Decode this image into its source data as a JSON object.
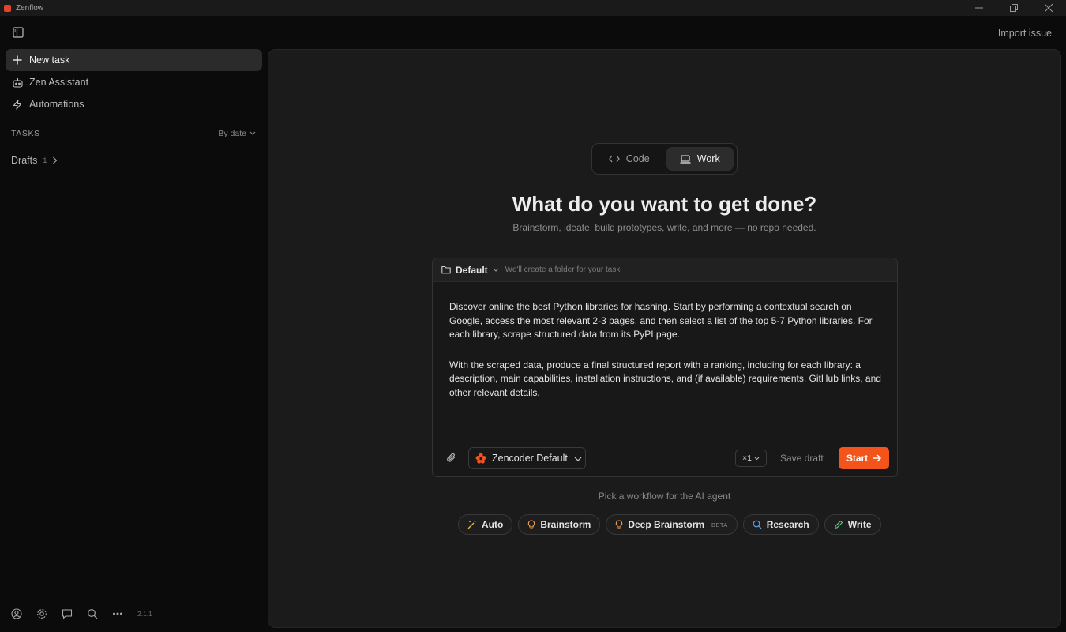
{
  "window": {
    "title": "Zenflow"
  },
  "header": {
    "import_issue": "Import issue"
  },
  "sidebar": {
    "nav": [
      {
        "label": "New task",
        "icon": "plus-icon",
        "active": true
      },
      {
        "label": "Zen Assistant",
        "icon": "robot-icon",
        "active": false
      },
      {
        "label": "Automations",
        "icon": "lightning-icon",
        "active": false
      }
    ],
    "tasks_label": "TASKS",
    "sort_label": "By date",
    "drafts": {
      "label": "Drafts",
      "count": "1"
    },
    "version": "2.1.1"
  },
  "main": {
    "modes": [
      {
        "label": "Code",
        "icon": "code-icon",
        "active": false
      },
      {
        "label": "Work",
        "icon": "laptop-icon",
        "active": true
      }
    ],
    "title": "What do you want to get done?",
    "subtitle": "Brainstorm, ideate, build prototypes, write, and more — no repo needed.",
    "composer": {
      "folder": "Default",
      "folder_hint": "We'll create a folder for your task",
      "paragraph1": "Discover online the best Python libraries for hashing. Start by performing a contextual search on Google, access the most relevant 2-3 pages, and then select a list of the top 5-7 Python libraries. For each library, scrape structured data from its PyPI page.",
      "paragraph2": "With the scraped data, produce a final structured report with a ranking, including for each library: a description, main capabilities, installation instructions, and (if available) requirements, GitHub links, and other relevant details.",
      "agent": "Zencoder Default",
      "count": "×1",
      "save_draft": "Save draft",
      "start": "Start"
    },
    "workflow_label": "Pick a workflow for the AI agent",
    "workflows": [
      {
        "label": "Auto",
        "icon": "magic-wand-icon",
        "color": "#e9b949"
      },
      {
        "label": "Brainstorm",
        "icon": "lightbulb-icon",
        "color": "#f0a35a"
      },
      {
        "label": "Deep Brainstorm",
        "icon": "lightbulb-icon",
        "color": "#f0a35a",
        "badge": "BETA"
      },
      {
        "label": "Research",
        "icon": "search-icon",
        "color": "#5aa7f0"
      },
      {
        "label": "Write",
        "icon": "pencil-icon",
        "color": "#5cc98a"
      }
    ]
  },
  "colors": {
    "accent": "#f2541b",
    "background": "#0b0b0b",
    "panel": "#1b1b1b"
  }
}
